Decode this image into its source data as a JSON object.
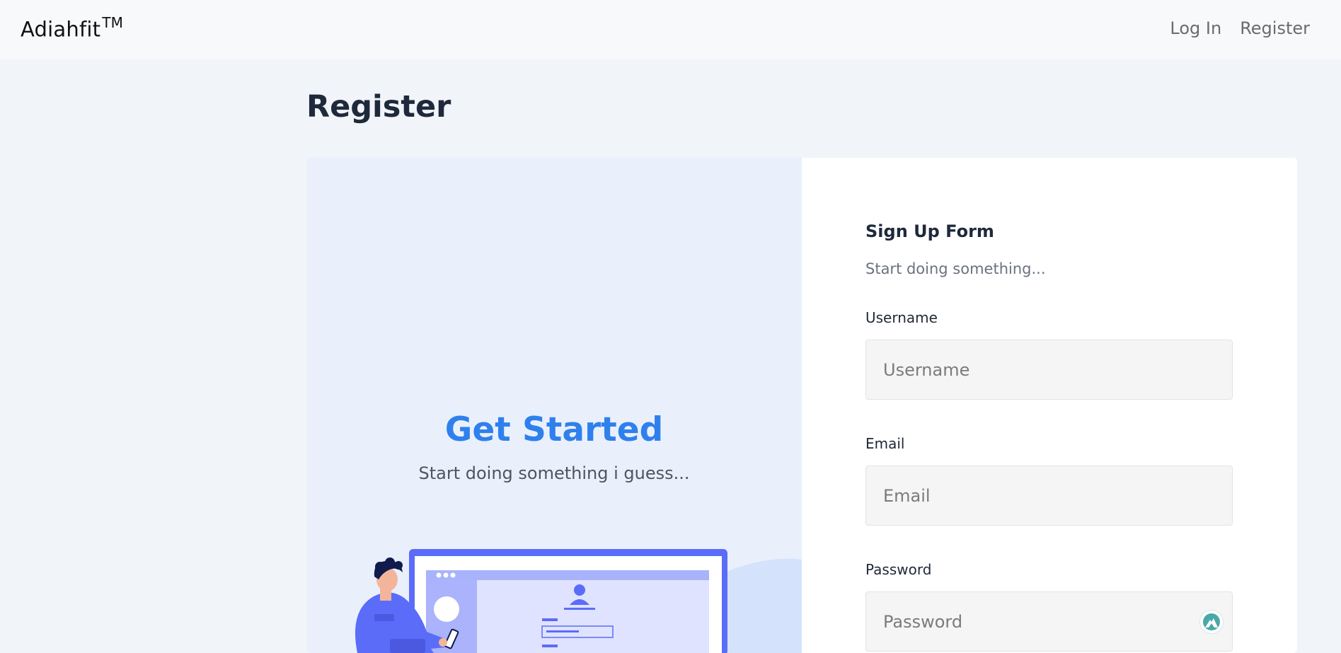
{
  "navbar": {
    "brand": "Adiahfit",
    "brand_sup": "TM",
    "links": [
      "Log In",
      "Register"
    ]
  },
  "page": {
    "title": "Register"
  },
  "hero": {
    "title": "Get Started",
    "subtitle": "Start doing something i guess..."
  },
  "form": {
    "title": "Sign Up Form",
    "subtitle": "Start doing something...",
    "fields": [
      {
        "label": "Username",
        "placeholder": "Username",
        "value": ""
      },
      {
        "label": "Email",
        "placeholder": "Email",
        "value": ""
      },
      {
        "label": "Password",
        "placeholder": "Password",
        "value": ""
      }
    ]
  },
  "icons": {
    "password_manager": "password-manager-icon"
  },
  "colors": {
    "accent": "#2f80ed",
    "illustration_primary": "#5b6cf9",
    "panel_background": "#e9f0fc",
    "page_background": "#f1f4f8"
  }
}
